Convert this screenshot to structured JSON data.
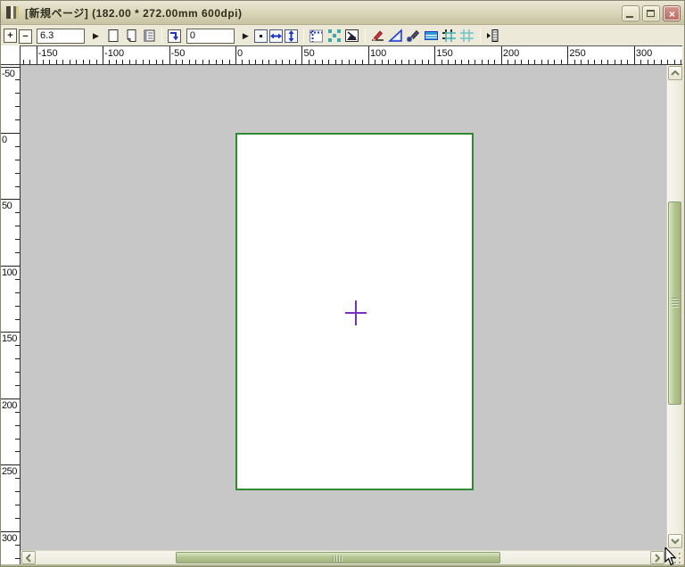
{
  "window": {
    "title": "[新規ページ] (182.00 * 272.00mm 600dpi)",
    "controls": {
      "close": "×"
    }
  },
  "toolbar": {
    "zoom_plus": "+",
    "zoom_minus": "−",
    "zoom_value": "6.3",
    "apply_zoom": "▶",
    "offset_value": "0",
    "apply_offset": "▶",
    "icons": [
      "zoom-in-button",
      "zoom-out-button",
      "zoom-value-input",
      "apply-zoom-button",
      "new-page-button",
      "duplicate-page-button",
      "page-list-button",
      "paste-move-button",
      "offset-value-input",
      "apply-offset-button",
      "dot-size-button",
      "fit-width-button",
      "fit-height-button",
      "show-rulers-button",
      "tile-pattern-button",
      "page-shape-button",
      "draw-line-button",
      "set-square-button",
      "pen-settings-button",
      "scale-bar-button",
      "grid-settings-button",
      "grid-display-button",
      "panel-toggle-button"
    ]
  },
  "rulers": {
    "unit": "mm",
    "horizontal_labels": [
      "-150",
      "-100",
      "-50",
      "0",
      "50",
      "100",
      "150",
      "200",
      "250",
      "300"
    ],
    "vertical_labels": [
      "-50",
      "0",
      "50",
      "100",
      "150",
      "200",
      "250",
      "300"
    ]
  },
  "page": {
    "width_mm": "182.00",
    "height_mm": "272.00",
    "dpi": "600dpi",
    "border_color": "#2e8b2e",
    "crosshair_color": "#7b2fbf"
  },
  "scrollbars": {
    "icons": [
      "scroll-up-button",
      "scroll-down-button",
      "scroll-left-button",
      "scroll-right-button",
      "vertical-thumb",
      "horizontal-thumb",
      "resize-grip"
    ]
  }
}
